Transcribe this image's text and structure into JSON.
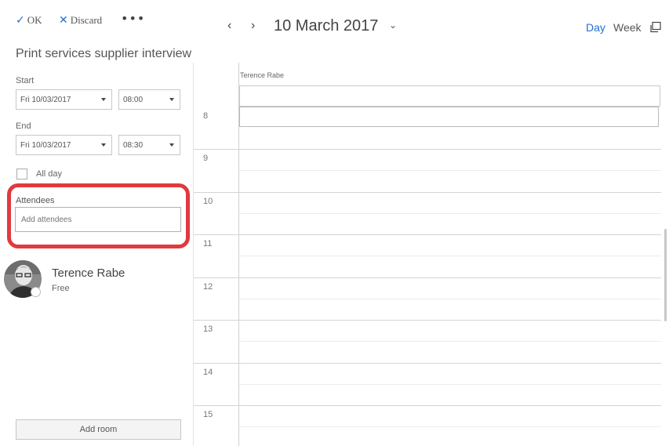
{
  "toolbar": {
    "ok_label": "OK",
    "discard_label": "Discard",
    "more_label": "•••"
  },
  "event": {
    "title": "Print services supplier interview",
    "start_label": "Start",
    "start_date": "Fri 10/03/2017",
    "start_time": "08:00",
    "end_label": "End",
    "end_date": "Fri 10/03/2017",
    "end_time": "08:30",
    "allday_label": "All day",
    "allday_checked": false
  },
  "attendees": {
    "label": "Attendees",
    "placeholder": "Add attendees",
    "list": [
      {
        "name": "Terence Rabe",
        "status": "Free"
      }
    ]
  },
  "add_room_label": "Add room",
  "calendar": {
    "prev_glyph": "‹",
    "next_glyph": "›",
    "date_title": "10 March 2017",
    "date_caret": "⌄",
    "view_day": "Day",
    "view_week": "Week",
    "active_view": "Day",
    "column_header": "Terence Rabe",
    "hours": [
      "8",
      "9",
      "10",
      "11",
      "12",
      "13",
      "14",
      "15"
    ]
  },
  "colors": {
    "accent": "#1f6fd0",
    "highlight": "#e03a3f"
  },
  "icons": {
    "ok": "checkmark-icon",
    "discard": "x-icon",
    "popout": "popout-window-icon"
  }
}
